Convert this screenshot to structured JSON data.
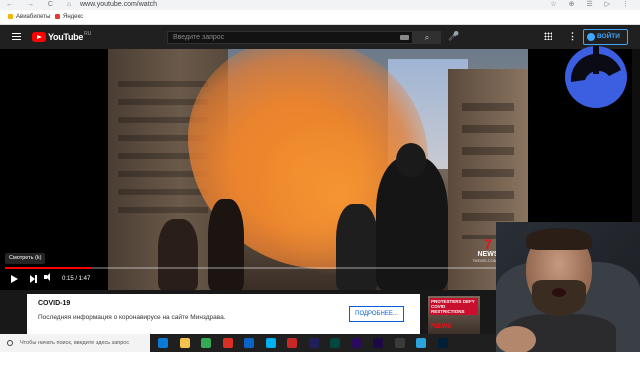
{
  "browser": {
    "url": "www.youtube.com/watch",
    "nav_glyphs": "← → C ⌂",
    "right_glyphs": "☆ ⊕ ☰ ▷ ⋮"
  },
  "bookmarks": [
    {
      "label": "Авиабилеты",
      "color": "#f4b400"
    },
    {
      "label": "Яндекс",
      "color": "#e53935"
    }
  ],
  "header": {
    "logo_text": "YouTube",
    "logo_region": "RU",
    "search_placeholder": "Введите запрос",
    "search_button": "⌕",
    "mic": "🎤",
    "more": "⋮",
    "signin_label": "ВОЙТИ"
  },
  "player": {
    "tooltip": "Смотреть (k)",
    "time": "0:15 / 1:47",
    "progress_fraction": 0.14,
    "news_seven": "7",
    "news_label": "NEWS",
    "news_sub": "7NEWS.COM.AU"
  },
  "covid": {
    "title": "COVID-19",
    "text": "Последняя информация о коронавирусе на сайте Минздрава.",
    "button": "ПОДРОБНЕЕ..."
  },
  "thumbnail": {
    "banner": "PROTESTERS DEFY COVID RESTRICTIONS",
    "seven": "7NEWS"
  },
  "taskbar": {
    "search_text": "Чтобы начать поиск, введите здесь запрос",
    "apps": [
      {
        "name": "edge",
        "color": "#0c7bd6"
      },
      {
        "name": "explorer",
        "color": "#f2c14e"
      },
      {
        "name": "chrome",
        "color": "#34a853"
      },
      {
        "name": "app-red",
        "color": "#d93025"
      },
      {
        "name": "mail",
        "color": "#0a64c8"
      },
      {
        "name": "skype",
        "color": "#00aff0"
      },
      {
        "name": "app-dark-red",
        "color": "#c62828"
      },
      {
        "name": "media-encoder",
        "color": "#1f1f5c"
      },
      {
        "name": "audition",
        "color": "#00473e"
      },
      {
        "name": "premiere",
        "color": "#2a0a5e"
      },
      {
        "name": "after-effects",
        "color": "#1d0a45"
      },
      {
        "name": "obs",
        "color": "#3a3a3a"
      },
      {
        "name": "telegram",
        "color": "#2aa3df"
      },
      {
        "name": "photoshop",
        "color": "#001e36"
      }
    ]
  },
  "colors": {
    "accent": "#3ea6ff",
    "brand": "#ff0000",
    "logo_blue": "#3b5fe0"
  }
}
